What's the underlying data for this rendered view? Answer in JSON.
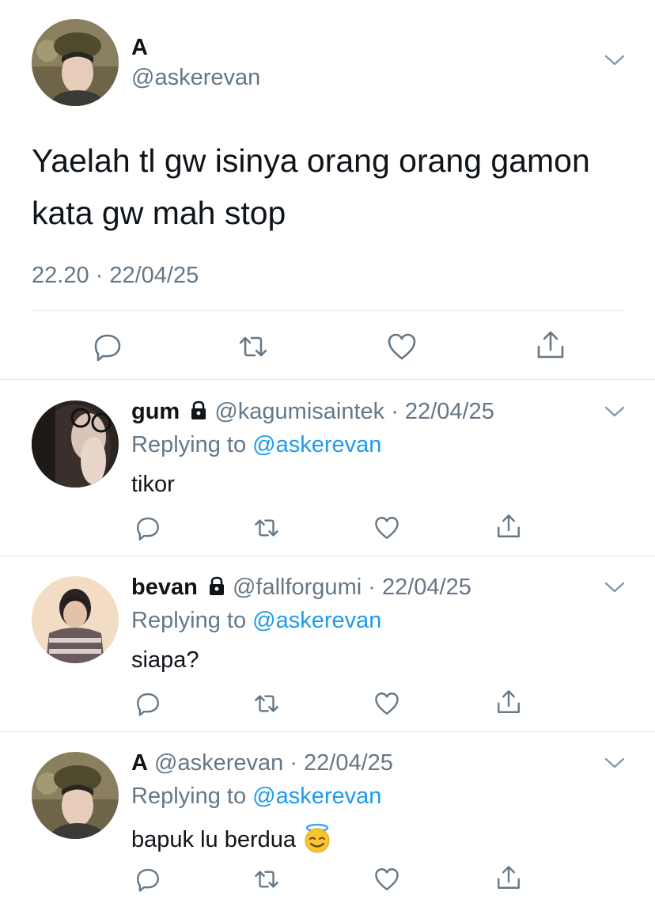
{
  "main_tweet": {
    "name": "A",
    "handle": "@askerevan",
    "text": "Yaelah tl gw isinya orang orang gamon kata gw mah stop",
    "timestamp": "22.20 · 22/04/25",
    "actions": [
      "reply-icon",
      "retweet-icon",
      "like-icon",
      "share-icon"
    ]
  },
  "replies": [
    {
      "name": "gum",
      "locked": true,
      "handle": "@kagumisaintek",
      "date": "· 22/04/25",
      "replying_prefix": "Replying to",
      "replying_to": "@askerevan",
      "text": "tikor"
    },
    {
      "name": "bevan",
      "locked": true,
      "handle": "@fallforgumi",
      "date": "· 22/04/25",
      "replying_prefix": "Replying to",
      "replying_to": "@askerevan",
      "text": "siapa?"
    },
    {
      "name": "A",
      "locked": false,
      "handle": "@askerevan",
      "date": "· 22/04/25",
      "replying_prefix": "Replying to",
      "replying_to": "@askerevan",
      "text": "bapuk lu berdua",
      "emoji": "smiling-face-with-halo-icon"
    }
  ],
  "colors": {
    "text": "#0f1419",
    "secondary": "#657786",
    "mention": "#1d9bf0",
    "divider": "#e1e8ed"
  }
}
